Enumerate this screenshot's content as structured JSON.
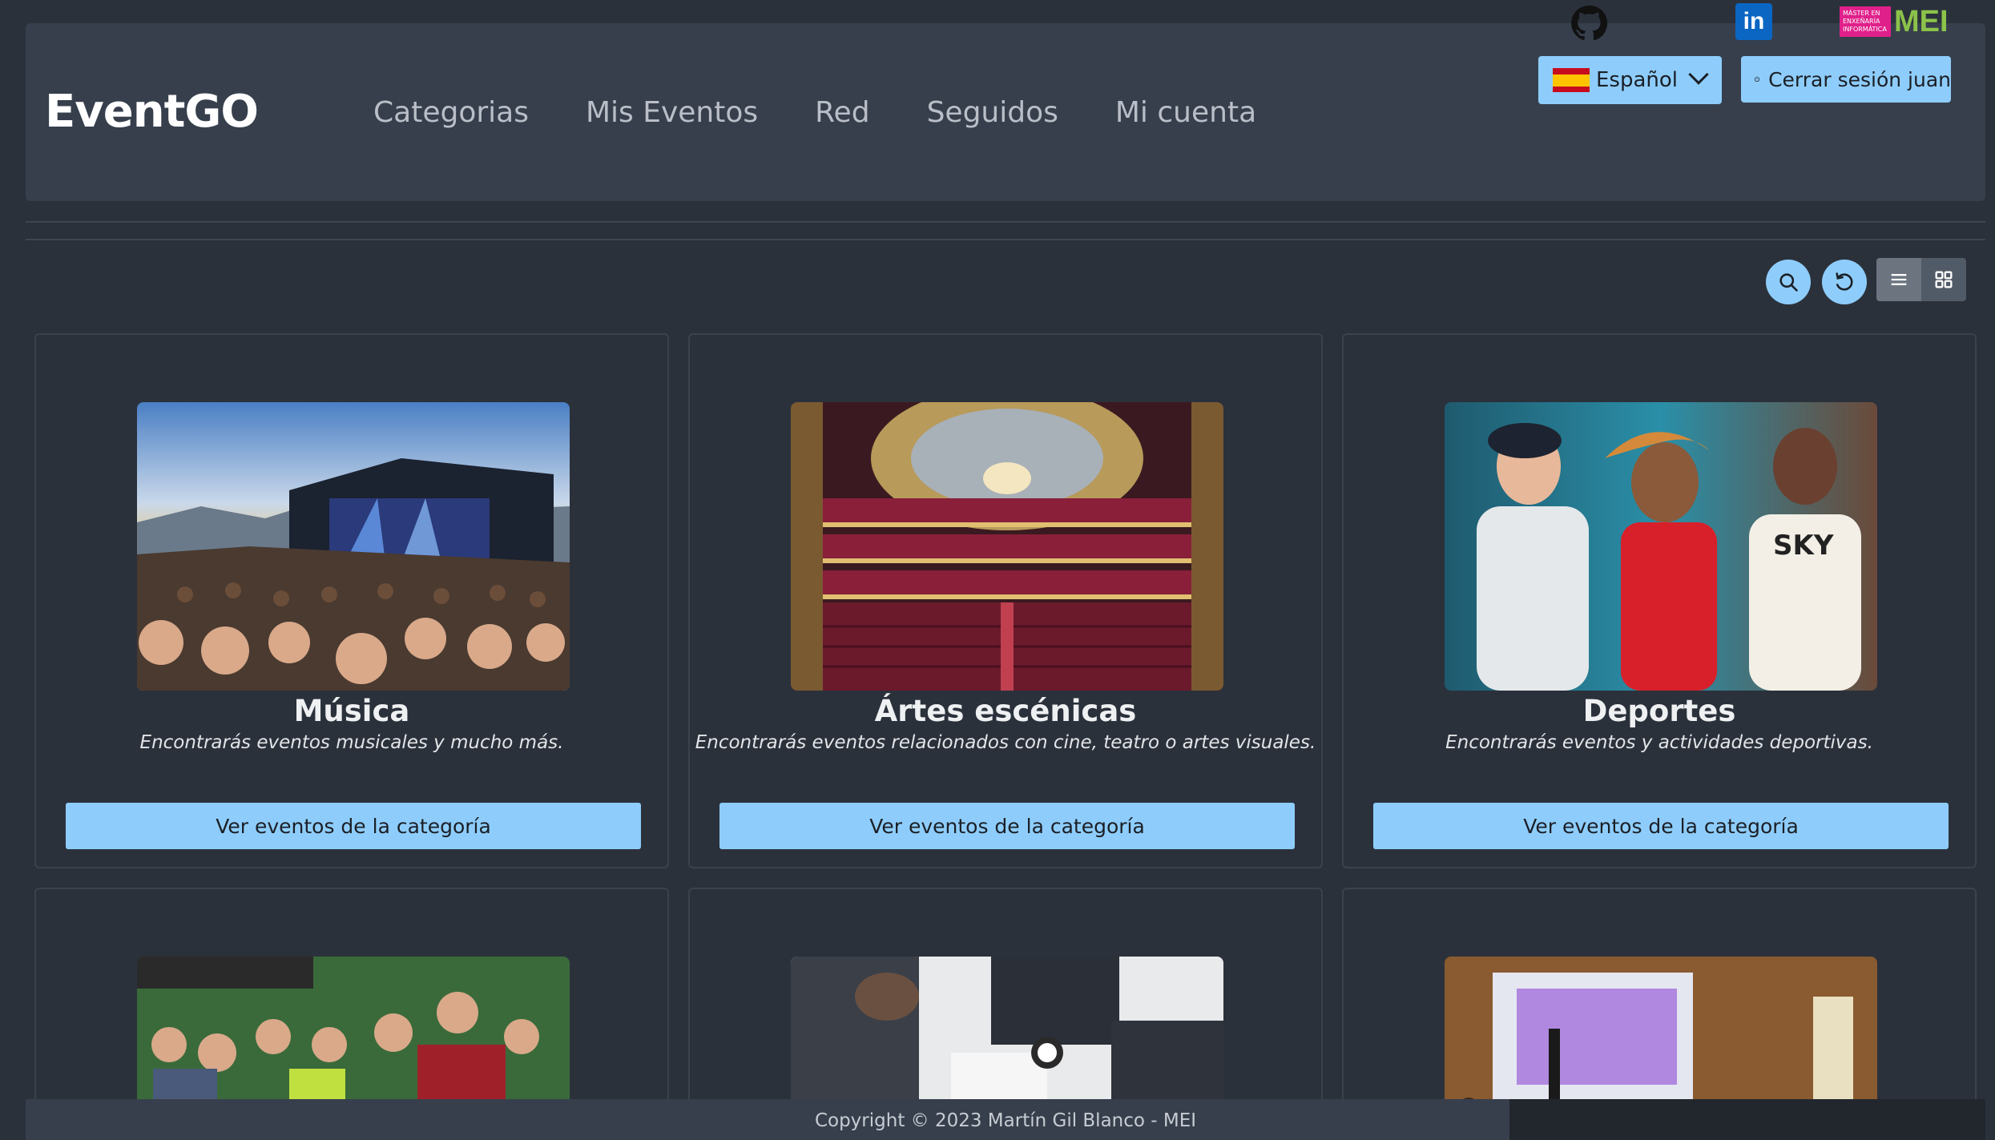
{
  "header": {
    "brand": "EventGO",
    "nav": [
      "Categorias",
      "Mis Eventos",
      "Red",
      "Seguidos",
      "Mi cuenta"
    ],
    "language": {
      "selected": "Español",
      "flag": "spain-flag-icon"
    },
    "logout_label": "Cerrar sesión juan"
  },
  "toolbar": {
    "icons": [
      "search-icon",
      "refresh-icon",
      "list-view-icon",
      "grid-view-icon"
    ],
    "active_view": "list"
  },
  "categories": [
    {
      "title": "Música",
      "description": "Encontrarás eventos musicales y mucho más.",
      "button": "Ver eventos de la categoría"
    },
    {
      "title": "Ártes escénicas",
      "description": "Encontrarás eventos relacionados con cine, teatro o artes visuales.",
      "button": "Ver eventos de la categoría"
    },
    {
      "title": "Deportes",
      "description": "Encontrarás eventos y actividades deportivas.",
      "button": "Ver eventos de la categoría"
    }
  ],
  "footer": {
    "copyright": "Copyright © 2023 Martín Gil Blanco - MEI",
    "mei_small": "MÁSTER EN ENXEÑARÍA INFORMÁTICA",
    "mei_large": "MEI"
  },
  "colors": {
    "background": "#2b313b",
    "navbar": "#373f4d",
    "accent": "#8ecdfb"
  }
}
